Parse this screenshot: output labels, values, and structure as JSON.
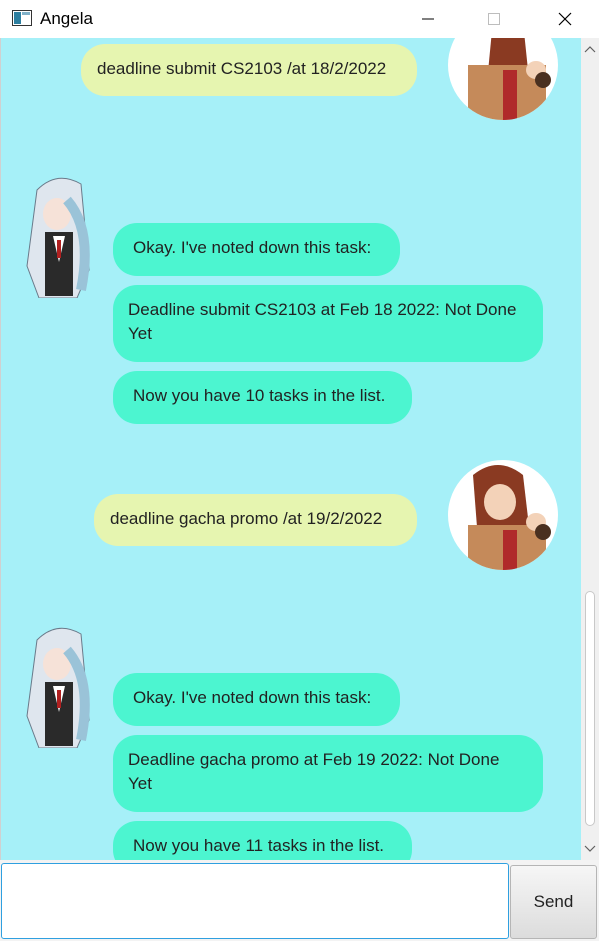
{
  "window": {
    "title": "Angela"
  },
  "colors": {
    "chat_background": "#a6f0f8",
    "user_bubble": "#e6f5b0",
    "bot_bubble": "#4cf5d0",
    "input_border": "#2fa0e0"
  },
  "messages": [
    {
      "sender": "user",
      "text": "deadline submit CS2103 /at 18/2/2022"
    },
    {
      "sender": "bot",
      "text": "Okay. I've noted down this task:"
    },
    {
      "sender": "bot",
      "text": "Deadline submit CS2103 at Feb 18 2022: Not Done Yet"
    },
    {
      "sender": "bot",
      "text": "Now you have 10 tasks in the list."
    },
    {
      "sender": "user",
      "text": "deadline gacha promo /at 19/2/2022"
    },
    {
      "sender": "bot",
      "text": "Okay. I've noted down this task:"
    },
    {
      "sender": "bot",
      "text": "Deadline gacha promo at Feb 19 2022: Not Done Yet"
    },
    {
      "sender": "bot",
      "text": "Now you have 11 tasks in the list."
    }
  ],
  "input": {
    "value": "",
    "send_label": "Send"
  },
  "icons": {
    "app": "app-window-icon",
    "minimize": "minimize-icon",
    "maximize": "maximize-icon",
    "close": "close-icon",
    "user_avatar": "user-avatar",
    "bot_avatar": "bot-avatar"
  }
}
